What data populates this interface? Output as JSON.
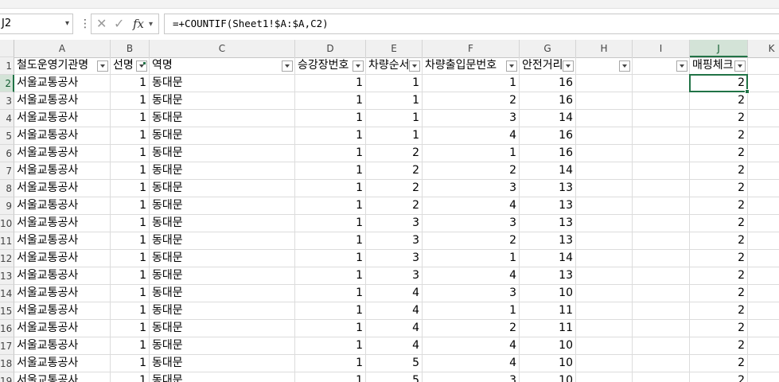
{
  "formula_bar": {
    "name_box": "J2",
    "formula": "=+COUNTIF(Sheet1!$A:$A,C2)"
  },
  "columns": [
    "A",
    "B",
    "C",
    "D",
    "E",
    "F",
    "G",
    "H",
    "I",
    "J",
    "K"
  ],
  "row_numbers": [
    "1",
    "2",
    "3",
    "4",
    "5",
    "6",
    "7",
    "8",
    "9",
    "10",
    "11",
    "12",
    "13",
    "14",
    "15",
    "16",
    "17",
    "18",
    "19"
  ],
  "headers": [
    "철도운영기관명",
    "선명",
    "역명",
    "승강장번호",
    "차량순서",
    "차량출입문번호",
    "안전거리",
    "",
    "",
    "매핑체크"
  ],
  "rows": [
    [
      "서울교통공사",
      "1",
      "동대문",
      "1",
      "1",
      "1",
      "16",
      "",
      "",
      "2"
    ],
    [
      "서울교통공사",
      "1",
      "동대문",
      "1",
      "1",
      "2",
      "16",
      "",
      "",
      "2"
    ],
    [
      "서울교통공사",
      "1",
      "동대문",
      "1",
      "1",
      "3",
      "14",
      "",
      "",
      "2"
    ],
    [
      "서울교통공사",
      "1",
      "동대문",
      "1",
      "1",
      "4",
      "16",
      "",
      "",
      "2"
    ],
    [
      "서울교통공사",
      "1",
      "동대문",
      "1",
      "2",
      "1",
      "16",
      "",
      "",
      "2"
    ],
    [
      "서울교통공사",
      "1",
      "동대문",
      "1",
      "2",
      "2",
      "14",
      "",
      "",
      "2"
    ],
    [
      "서울교통공사",
      "1",
      "동대문",
      "1",
      "2",
      "3",
      "13",
      "",
      "",
      "2"
    ],
    [
      "서울교통공사",
      "1",
      "동대문",
      "1",
      "2",
      "4",
      "13",
      "",
      "",
      "2"
    ],
    [
      "서울교통공사",
      "1",
      "동대문",
      "1",
      "3",
      "3",
      "13",
      "",
      "",
      "2"
    ],
    [
      "서울교통공사",
      "1",
      "동대문",
      "1",
      "3",
      "2",
      "13",
      "",
      "",
      "2"
    ],
    [
      "서울교통공사",
      "1",
      "동대문",
      "1",
      "3",
      "1",
      "14",
      "",
      "",
      "2"
    ],
    [
      "서울교통공사",
      "1",
      "동대문",
      "1",
      "3",
      "4",
      "13",
      "",
      "",
      "2"
    ],
    [
      "서울교통공사",
      "1",
      "동대문",
      "1",
      "4",
      "3",
      "10",
      "",
      "",
      "2"
    ],
    [
      "서울교통공사",
      "1",
      "동대문",
      "1",
      "4",
      "1",
      "11",
      "",
      "",
      "2"
    ],
    [
      "서울교통공사",
      "1",
      "동대문",
      "1",
      "4",
      "2",
      "11",
      "",
      "",
      "2"
    ],
    [
      "서울교통공사",
      "1",
      "동대문",
      "1",
      "4",
      "4",
      "10",
      "",
      "",
      "2"
    ],
    [
      "서울교통공사",
      "1",
      "동대문",
      "1",
      "5",
      "4",
      "10",
      "",
      "",
      "2"
    ],
    [
      "서울교통공사",
      "1",
      "동대문",
      "1",
      "5",
      "3",
      "10",
      "",
      "",
      "2"
    ]
  ],
  "theme": {
    "accent": "#217346",
    "header_bg": "#f0f0f0",
    "selected_header_bg": "#d3e3d7"
  }
}
